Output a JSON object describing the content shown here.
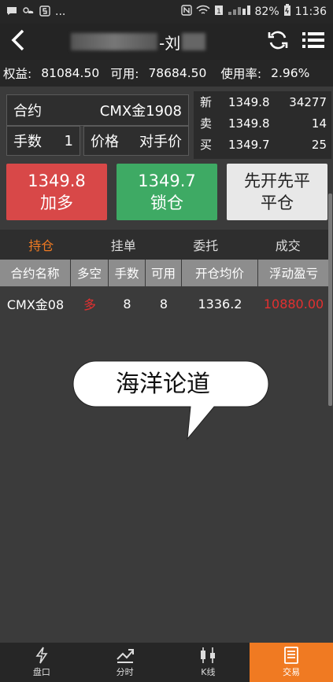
{
  "status_bar": {
    "dots": "...",
    "battery": "82%",
    "time": "11:36"
  },
  "header": {
    "title": "-刘"
  },
  "account": {
    "equity_label": "权益:",
    "equity": "81084.50",
    "available_label": "可用:",
    "available": "78684.50",
    "usage_label": "使用率:",
    "usage": "2.96%"
  },
  "order": {
    "contract_label": "合约",
    "contract_value": "CMX金1908",
    "qty_label": "手数",
    "qty_value": "1",
    "price_label": "价格",
    "price_value": "对手价"
  },
  "quote": [
    {
      "label": "新",
      "price": "1349.8",
      "volume": "34277"
    },
    {
      "label": "卖",
      "price": "1349.8",
      "volume": "14"
    },
    {
      "label": "买",
      "price": "1349.7",
      "volume": "25"
    }
  ],
  "buttons": {
    "buy_price": "1349.8",
    "buy_label": "加多",
    "lock_price": "1349.7",
    "lock_label": "锁仓",
    "close_line1": "先开先平",
    "close_label": "平仓"
  },
  "tabs": [
    "持仓",
    "挂单",
    "委托",
    "成交"
  ],
  "table": {
    "headers": [
      "合约名称",
      "多空",
      "手数",
      "可用",
      "开仓均价",
      "浮动盈亏"
    ],
    "rows": [
      [
        "CMX金08",
        "多",
        "8",
        "8",
        "1336.2",
        "10880.00"
      ]
    ]
  },
  "watermark": "海洋论道",
  "nav": [
    "盘口",
    "分时",
    "K线",
    "交易"
  ],
  "colors": {
    "accent": "#f07a22",
    "buy": "#d84848",
    "lock": "#3eaa64",
    "loss_profit": "#e23030"
  },
  "icons": [
    "back-arrow-icon",
    "refresh-icon",
    "menu-list-icon",
    "lightning-icon",
    "trend-line-icon",
    "candlestick-icon",
    "document-icon"
  ]
}
